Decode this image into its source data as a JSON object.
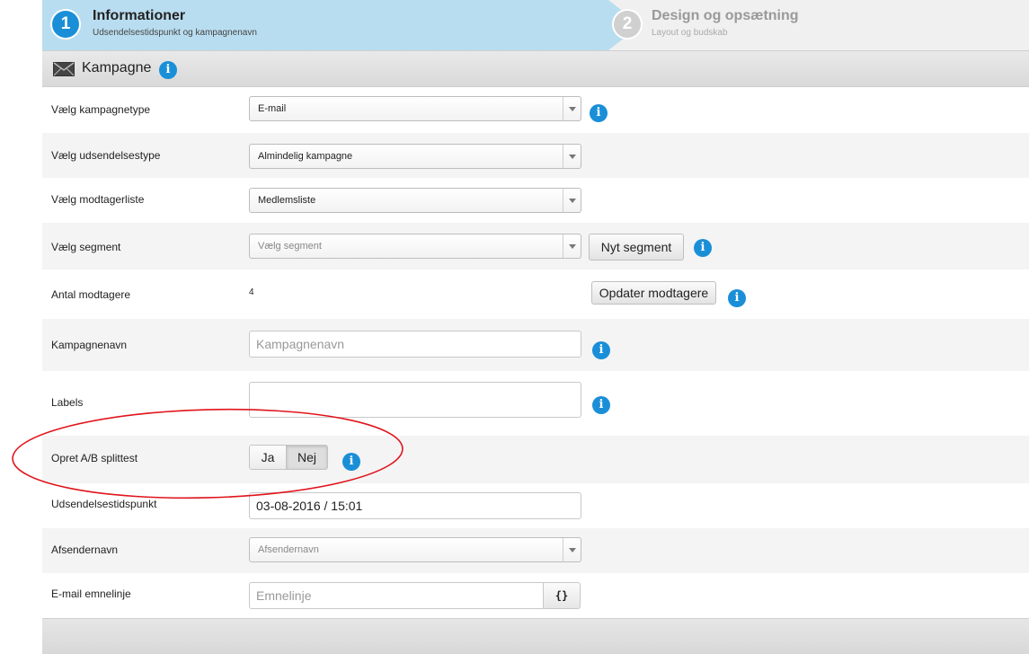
{
  "steps": [
    {
      "number": "1",
      "title": "Informationer",
      "subtitle": "Udsendelsestidspunkt og kampagnenavn"
    },
    {
      "number": "2",
      "title": "Design og opsætning",
      "subtitle": "Layout og budskab"
    }
  ],
  "section": {
    "title": "Kampagne",
    "icon": "envelope-icon"
  },
  "info_glyph": "i",
  "form": {
    "campaign_type": {
      "label": "Vælg kampagnetype",
      "value": "E-mail"
    },
    "send_type": {
      "label": "Vælg udsendelsestype",
      "value": "Almindelig kampagne"
    },
    "recipient_list": {
      "label": "Vælg modtagerliste",
      "value": "Medlemsliste"
    },
    "segment": {
      "label": "Vælg segment",
      "placeholder": "Vælg segment",
      "button": "Nyt segment"
    },
    "recipients": {
      "label": "Antal modtagere",
      "count": "4",
      "button": "Opdater modtagere"
    },
    "campaign_name": {
      "label": "Kampagnenavn",
      "placeholder": "Kampagnenavn"
    },
    "labels": {
      "label": "Labels",
      "value": ""
    },
    "ab_test": {
      "label": "Opret A/B splittest",
      "yes": "Ja",
      "no": "Nej",
      "selected": "Nej"
    },
    "send_time": {
      "label": "Udsendelsestidspunkt",
      "value": "03-08-2016 / 15:01"
    },
    "sender_name": {
      "label": "Afsendernavn",
      "placeholder": "Afsendernavn"
    },
    "subject": {
      "label": "E-mail emnelinje",
      "placeholder": "Emnelinje",
      "merge_button": "{}"
    }
  },
  "colors": {
    "accent": "#1a8fd8",
    "step_active": "#b9ddf0",
    "annotation": "#e0141c"
  }
}
